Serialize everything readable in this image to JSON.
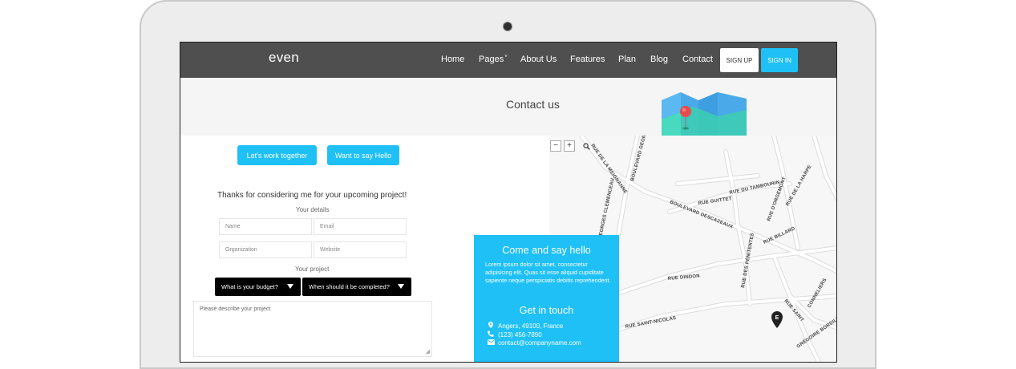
{
  "nav": {
    "brand": "even",
    "items": [
      "Home",
      "Pages",
      "About Us",
      "Features",
      "Plan",
      "Blog",
      "Contact"
    ],
    "pages_caret": "˅",
    "signup": "SIGN UP",
    "signin": "SIGN IN"
  },
  "banner": {
    "title": "Contact us"
  },
  "tabs": {
    "work": "Let's work together",
    "hello": "Want to say Hello"
  },
  "form": {
    "thanks": "Thanks for considering me for your upcoming project!",
    "details_label": "Your details",
    "name_ph": "Name",
    "email_ph": "Email",
    "org_ph": "Organization",
    "website_ph": "Website",
    "project_label": "Your project",
    "budget": "What is your budget?",
    "timeline": "When should it be completed?",
    "describe_ph": "Please describe your project"
  },
  "map": {
    "zoom_out": "−",
    "zoom_in": "+",
    "streets": [
      "RUE DE LA MEIGNANNE",
      "BOULEVARD GEORGE",
      "BOULEVARD GEORGES CLEMENCEAU",
      "BOULEVARD DESCAZEAUX",
      "RUE DU TAMBOURIN",
      "RUE GUITTET",
      "RUE DE LA HARPE",
      "RUE D'ORGEMONT",
      "RUE BILLARD",
      "RUE DINDON",
      "RUE DES PÉNITENTES",
      "RUE SAINT-NICOLAS",
      "RUE SAINT",
      "GRÉGOIRE BORDILLON",
      "CONNELIERS"
    ],
    "marker": "E"
  },
  "card": {
    "title": "Come and say hello",
    "text": "Lorem ipsum dolor sit amet, consectetur adipisicing elit. Quas sit esse aliquid cupiditate sapiente neque perspiciatis debitis reprehenderit.",
    "subtitle": "Get in touch",
    "address": "Angers, 49100, France",
    "phone": "(123) 456-7890",
    "email": "contact@companyname.com"
  },
  "colors": {
    "accent": "#1ec0f5",
    "nav": "#4f4f4f",
    "banner": "#f5f5f5"
  },
  "icons": [
    "map-pin-icon",
    "phone-icon",
    "envelope-icon",
    "search-icon",
    "map-illustration-icon"
  ]
}
